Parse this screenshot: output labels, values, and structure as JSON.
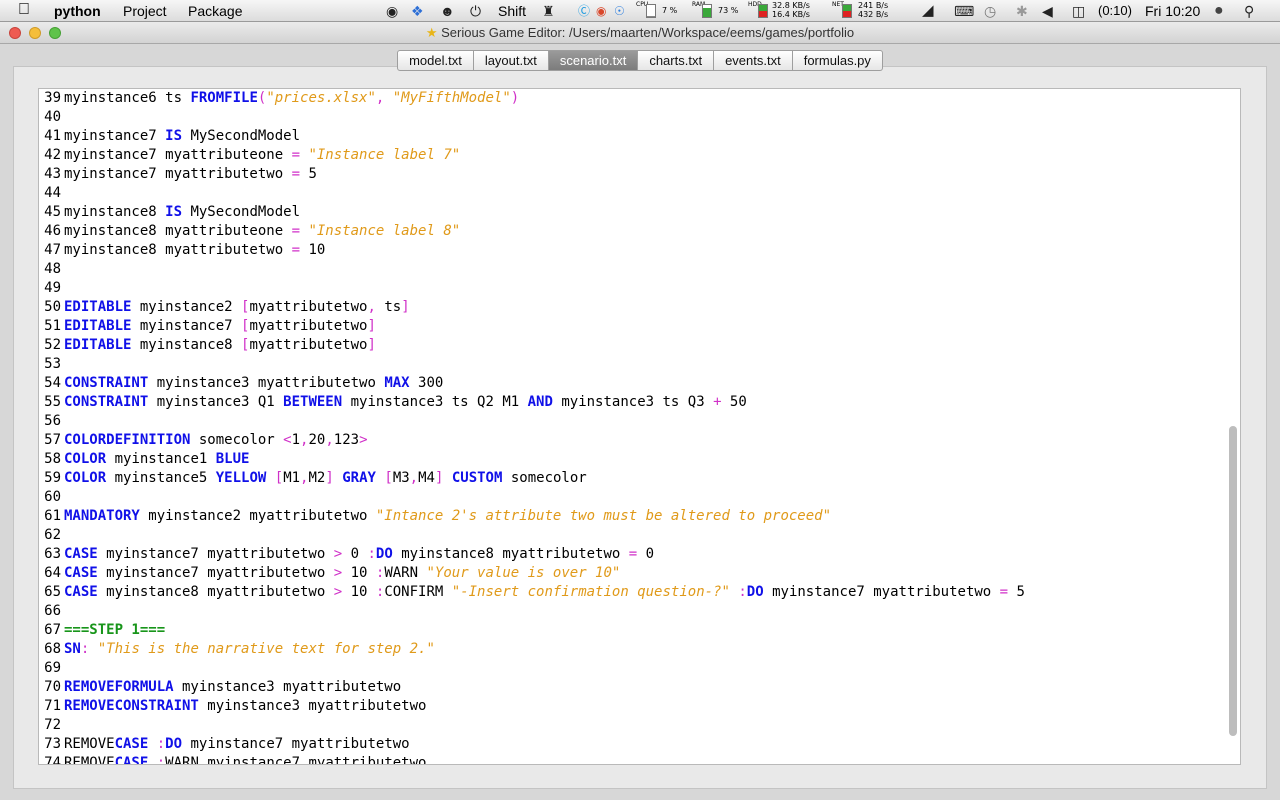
{
  "menubar": {
    "app_name": "python",
    "menus": [
      "Project",
      "Package"
    ],
    "shift_label": "Shift",
    "cpu_label": "CPU",
    "cpu_value": "7 %",
    "ram_label": "RAM",
    "ram_value": "73 %",
    "hdd_label": "HDD",
    "hdd_read": "32.8 KB/s",
    "hdd_write": "16.4 KB/s",
    "net_label": "NET",
    "net_in": "241 B/s",
    "net_out": "432 B/s",
    "battery": "(0:10)",
    "clock": "Fri 10:20",
    "icons": [
      "apple-icon",
      "evernote-icon",
      "dropbox-icon",
      "growl-icon",
      "power-icon",
      "alien-icon",
      "skype-icon",
      "chrome-icon",
      "safari-icon",
      "wifi-icon",
      "keyboard-icon",
      "timemachine-icon",
      "bluetooth-icon",
      "volume-icon",
      "battery-icon",
      "user-icon",
      "spotlight-icon"
    ]
  },
  "window": {
    "title": "Serious Game Editor: /Users/maarten/Workspace/eems/games/portfolio",
    "title_icon": "star-icon"
  },
  "tabs": [
    {
      "label": "model.txt",
      "active": false
    },
    {
      "label": "layout.txt",
      "active": false
    },
    {
      "label": "scenario.txt",
      "active": true
    },
    {
      "label": "charts.txt",
      "active": false
    },
    {
      "label": "events.txt",
      "active": false
    },
    {
      "label": "formulas.py",
      "active": false
    }
  ],
  "colors": {
    "keyword": "#1010e8",
    "string": "#e09a1a",
    "operator": "#d030c8",
    "step_marker": "#18951a"
  },
  "code": [
    {
      "n": "39",
      "t": [
        [
          "myinstance6 ts ",
          ""
        ],
        [
          "FROMFILE",
          "kw"
        ],
        [
          "(",
          "op"
        ],
        [
          "\"prices.xlsx\"",
          "str"
        ],
        [
          ", ",
          "op"
        ],
        [
          "\"MyFifthModel\"",
          "str"
        ],
        [
          ")",
          "op"
        ]
      ]
    },
    {
      "n": "40",
      "t": []
    },
    {
      "n": "41",
      "t": [
        [
          "myinstance7 ",
          ""
        ],
        [
          "IS",
          "kw"
        ],
        [
          " MySecondModel",
          ""
        ]
      ]
    },
    {
      "n": "42",
      "t": [
        [
          "myinstance7 myattributeone ",
          ""
        ],
        [
          "=",
          "op"
        ],
        [
          " ",
          ""
        ],
        [
          "\"Instance label 7\"",
          "str"
        ]
      ]
    },
    {
      "n": "43",
      "t": [
        [
          "myinstance7 myattributetwo ",
          ""
        ],
        [
          "=",
          "op"
        ],
        [
          " 5",
          ""
        ]
      ]
    },
    {
      "n": "44",
      "t": []
    },
    {
      "n": "45",
      "t": [
        [
          "myinstance8 ",
          ""
        ],
        [
          "IS",
          "kw"
        ],
        [
          " MySecondModel",
          ""
        ]
      ]
    },
    {
      "n": "46",
      "t": [
        [
          "myinstance8 myattributeone ",
          ""
        ],
        [
          "=",
          "op"
        ],
        [
          " ",
          ""
        ],
        [
          "\"Instance label 8\"",
          "str"
        ]
      ]
    },
    {
      "n": "47",
      "t": [
        [
          "myinstance8 myattributetwo ",
          ""
        ],
        [
          "=",
          "op"
        ],
        [
          " 10",
          ""
        ]
      ]
    },
    {
      "n": "48",
      "t": []
    },
    {
      "n": "49",
      "t": []
    },
    {
      "n": "50",
      "t": [
        [
          "EDITABLE",
          "kw"
        ],
        [
          " myinstance2 ",
          ""
        ],
        [
          "[",
          "op"
        ],
        [
          "myattributetwo",
          ""
        ],
        [
          ",",
          "op"
        ],
        [
          " ts",
          ""
        ],
        [
          "]",
          "op"
        ]
      ]
    },
    {
      "n": "51",
      "t": [
        [
          "EDITABLE",
          "kw"
        ],
        [
          " myinstance7 ",
          ""
        ],
        [
          "[",
          "op"
        ],
        [
          "myattributetwo",
          ""
        ],
        [
          "]",
          "op"
        ]
      ]
    },
    {
      "n": "52",
      "t": [
        [
          "EDITABLE",
          "kw"
        ],
        [
          " myinstance8 ",
          ""
        ],
        [
          "[",
          "op"
        ],
        [
          "myattributetwo",
          ""
        ],
        [
          "]",
          "op"
        ]
      ]
    },
    {
      "n": "53",
      "t": []
    },
    {
      "n": "54",
      "t": [
        [
          "CONSTRAINT",
          "kw"
        ],
        [
          " myinstance3 myattributetwo ",
          ""
        ],
        [
          "MAX",
          "kw"
        ],
        [
          " 300",
          ""
        ]
      ]
    },
    {
      "n": "55",
      "t": [
        [
          "CONSTRAINT",
          "kw"
        ],
        [
          " myinstance3 Q1 ",
          ""
        ],
        [
          "BETWEEN",
          "kw"
        ],
        [
          " myinstance3 ts Q2 M1 ",
          ""
        ],
        [
          "AND",
          "kw"
        ],
        [
          " myinstance3 ts Q3 ",
          ""
        ],
        [
          "+",
          "op"
        ],
        [
          " 50",
          ""
        ]
      ]
    },
    {
      "n": "56",
      "t": []
    },
    {
      "n": "57",
      "t": [
        [
          "COLORDEFINITION",
          "kw"
        ],
        [
          " somecolor ",
          ""
        ],
        [
          "<",
          "op"
        ],
        [
          "1",
          ""
        ],
        [
          ",",
          "op"
        ],
        [
          "20",
          ""
        ],
        [
          ",",
          "op"
        ],
        [
          "123",
          ""
        ],
        [
          ">",
          "op"
        ]
      ]
    },
    {
      "n": "58",
      "t": [
        [
          "COLOR",
          "kw"
        ],
        [
          " myinstance1 ",
          ""
        ],
        [
          "BLUE",
          "kw"
        ]
      ]
    },
    {
      "n": "59",
      "t": [
        [
          "COLOR",
          "kw"
        ],
        [
          " myinstance5 ",
          ""
        ],
        [
          "YELLOW",
          "kw"
        ],
        [
          " ",
          ""
        ],
        [
          "[",
          "op"
        ],
        [
          "M1",
          ""
        ],
        [
          ",",
          "op"
        ],
        [
          "M2",
          ""
        ],
        [
          "]",
          "op"
        ],
        [
          " ",
          ""
        ],
        [
          "GRAY",
          "kw"
        ],
        [
          " ",
          ""
        ],
        [
          "[",
          "op"
        ],
        [
          "M3",
          ""
        ],
        [
          ",",
          "op"
        ],
        [
          "M4",
          ""
        ],
        [
          "]",
          "op"
        ],
        [
          " ",
          ""
        ],
        [
          "CUSTOM",
          "kw"
        ],
        [
          " somecolor",
          ""
        ]
      ]
    },
    {
      "n": "60",
      "t": []
    },
    {
      "n": "61",
      "t": [
        [
          "MANDATORY",
          "kw"
        ],
        [
          " myinstance2 myattributetwo ",
          ""
        ],
        [
          "\"Intance 2's attribute two must be altered to proceed\"",
          "str"
        ]
      ]
    },
    {
      "n": "62",
      "t": []
    },
    {
      "n": "63",
      "t": [
        [
          "CASE",
          "kw"
        ],
        [
          " myinstance7 myattributetwo ",
          ""
        ],
        [
          ">",
          "op"
        ],
        [
          " 0 ",
          ""
        ],
        [
          ":",
          "op"
        ],
        [
          "DO",
          "kw"
        ],
        [
          " myinstance8 myattributetwo ",
          ""
        ],
        [
          "=",
          "op"
        ],
        [
          " 0",
          ""
        ]
      ]
    },
    {
      "n": "64",
      "t": [
        [
          "CASE",
          "kw"
        ],
        [
          " myinstance7 myattributetwo ",
          ""
        ],
        [
          ">",
          "op"
        ],
        [
          " 10 ",
          ""
        ],
        [
          ":",
          "op"
        ],
        [
          "WARN ",
          ""
        ],
        [
          "\"Your value is over 10\"",
          "str"
        ]
      ]
    },
    {
      "n": "65",
      "t": [
        [
          "CASE",
          "kw"
        ],
        [
          " myinstance8 myattributetwo ",
          ""
        ],
        [
          ">",
          "op"
        ],
        [
          " 10 ",
          ""
        ],
        [
          ":",
          "op"
        ],
        [
          "CONFIRM ",
          ""
        ],
        [
          "\"-Insert confirmation question-?\"",
          "str"
        ],
        [
          " ",
          ""
        ],
        [
          ":",
          "op"
        ],
        [
          "DO",
          "kw"
        ],
        [
          " myinstance7 myattributetwo ",
          ""
        ],
        [
          "=",
          "op"
        ],
        [
          " 5",
          ""
        ]
      ]
    },
    {
      "n": "66",
      "t": []
    },
    {
      "n": "67",
      "t": [
        [
          "===STEP 1===",
          "st1"
        ]
      ]
    },
    {
      "n": "68",
      "t": [
        [
          "SN",
          "kw"
        ],
        [
          ":",
          "op"
        ],
        [
          " ",
          ""
        ],
        [
          "\"This is the narrative text for step 2.\"",
          "str"
        ]
      ]
    },
    {
      "n": "69",
      "t": []
    },
    {
      "n": "70",
      "t": [
        [
          "REMOVEFORMULA",
          "kw"
        ],
        [
          " myinstance3 myattributetwo",
          ""
        ]
      ]
    },
    {
      "n": "71",
      "t": [
        [
          "REMOVECONSTRAINT",
          "kw"
        ],
        [
          " myinstance3 myattributetwo",
          ""
        ]
      ]
    },
    {
      "n": "72",
      "t": []
    },
    {
      "n": "73",
      "t": [
        [
          "REMOVE",
          ""
        ],
        [
          "CASE",
          "kw"
        ],
        [
          " ",
          ""
        ],
        [
          ":",
          "op"
        ],
        [
          "DO",
          "kw"
        ],
        [
          " myinstance7 myattributetwo",
          ""
        ]
      ]
    },
    {
      "n": "74",
      "t": [
        [
          "REMOVE",
          ""
        ],
        [
          "CASE",
          "kw"
        ],
        [
          " ",
          ""
        ],
        [
          ":",
          "op"
        ],
        [
          "WARN myinstance7 myattributetwo",
          ""
        ]
      ]
    }
  ]
}
